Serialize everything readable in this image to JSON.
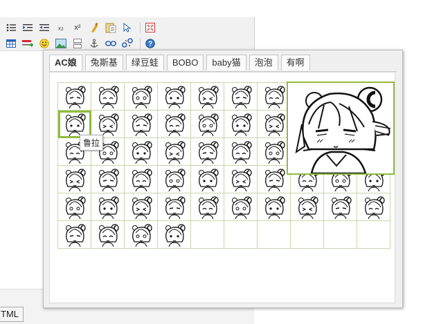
{
  "toolbar": {
    "row1": [
      "list-bullets-icon",
      "indent-icon",
      "outdent-icon",
      "subscript-icon",
      "superscript-icon",
      "clear-format-icon",
      "paste-text-icon",
      "select-icon",
      "fullscreen-icon"
    ],
    "row2": [
      "table-icon",
      "insert-row-icon",
      "emotion-icon",
      "image-icon",
      "page-break-icon",
      "anchor-icon",
      "link-icon",
      "unlink-icon",
      "help-icon"
    ],
    "labels": {
      "subscript": "ₓ₂",
      "superscript": "x²"
    }
  },
  "html_button": {
    "label": "TML"
  },
  "dialog": {
    "tabs": [
      "AC娘",
      "兔斯基",
      "绿豆蛙",
      "BOBO",
      "baby猫",
      "泡泡",
      "有啊"
    ],
    "active_tab": 0,
    "tooltip": "鲁拉",
    "grid": {
      "rows": 6,
      "cols": 10,
      "filled": [
        10,
        10,
        10,
        10,
        10,
        4
      ],
      "hover_index": 10
    }
  },
  "colors": {
    "accent": "#8fbc3c",
    "grid_border": "#c7d6a8"
  }
}
